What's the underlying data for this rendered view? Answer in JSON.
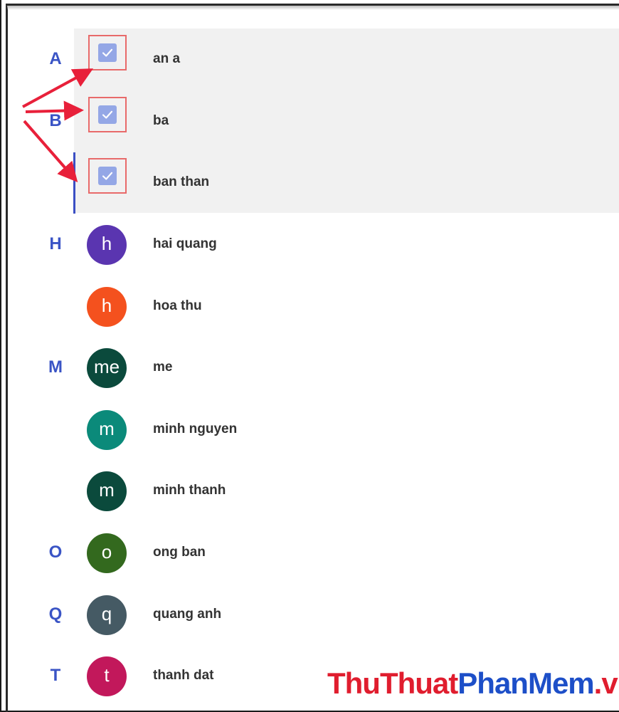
{
  "colors": {
    "letter": "#3a54c5",
    "selected_background": "#f1f1f1",
    "checkbox": "#94a7e6",
    "annotation_red": "#e8203a",
    "watermark_red": "#e01d2e",
    "watermark_blue": "#1d4fc8"
  },
  "selected_contacts": [
    {
      "letter": "A",
      "name": "an a",
      "checked": true
    },
    {
      "letter": "B",
      "name": "ba",
      "checked": true
    },
    {
      "letter": "",
      "name": "ban than",
      "checked": true
    }
  ],
  "contacts": [
    {
      "letter": "H",
      "initial": "h",
      "name": "hai quang",
      "avatar_color": "#5a35b0"
    },
    {
      "letter": "",
      "initial": "h",
      "name": "hoa thu",
      "avatar_color": "#f4511e"
    },
    {
      "letter": "M",
      "initial": "me",
      "name": "me",
      "avatar_color": "#0b4a3c"
    },
    {
      "letter": "",
      "initial": "m",
      "name": "minh nguyen",
      "avatar_color": "#0b8a7a"
    },
    {
      "letter": "",
      "initial": "m",
      "name": "minh thanh",
      "avatar_color": "#0b4a3c"
    },
    {
      "letter": "O",
      "initial": "o",
      "name": "ong ban",
      "avatar_color": "#33691e"
    },
    {
      "letter": "Q",
      "initial": "q",
      "name": "quang anh",
      "avatar_color": "#455a64"
    },
    {
      "letter": "T",
      "initial": "t",
      "name": "thanh dat",
      "avatar_color": "#c2185b"
    }
  ],
  "watermark": {
    "part1": "ThuThuat",
    "part2": "PhanMem",
    "part3": ".vn"
  }
}
